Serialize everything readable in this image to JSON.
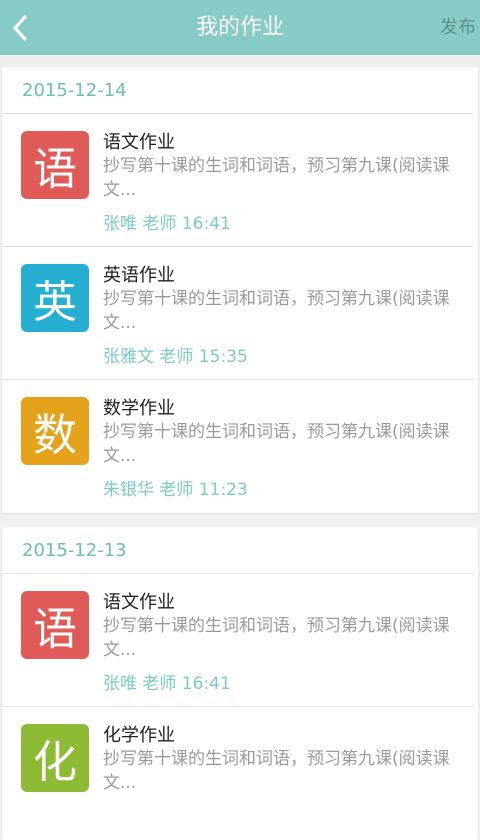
{
  "header": {
    "title": "我的作业",
    "publish_label": "发布",
    "back_icon": "chevron-left-icon"
  },
  "groups": [
    {
      "date": "2015-12-14",
      "items": [
        {
          "icon_char": "语",
          "icon_color": "#e05a57",
          "title": "语文作业",
          "desc": "抄写第十课的生词和词语，预习第九课(阅读课文...",
          "meta": "张唯 老师 16:41"
        },
        {
          "icon_char": "英",
          "icon_color": "#26afd0",
          "title": "英语作业",
          "desc": "抄写第十课的生词和词语，预习第九课(阅读课文...",
          "meta": "张雅文 老师 15:35"
        },
        {
          "icon_char": "数",
          "icon_color": "#e5a21b",
          "title": "数学作业",
          "desc": "抄写第十课的生词和词语，预习第九课(阅读课文...",
          "meta": "朱银华 老师 11:23"
        }
      ]
    },
    {
      "date": "2015-12-13",
      "items": [
        {
          "icon_char": "语",
          "icon_color": "#e05a57",
          "title": "语文作业",
          "desc": "抄写第十课的生词和词语，预习第九课(阅读课文...",
          "meta": "张唯 老师 16:41"
        },
        {
          "icon_char": "化",
          "icon_color": "#8dbb34",
          "title": "化学作业",
          "desc": "抄写第十课的生词和词语，预习第九课(阅读课文...",
          "meta": ""
        }
      ]
    }
  ]
}
